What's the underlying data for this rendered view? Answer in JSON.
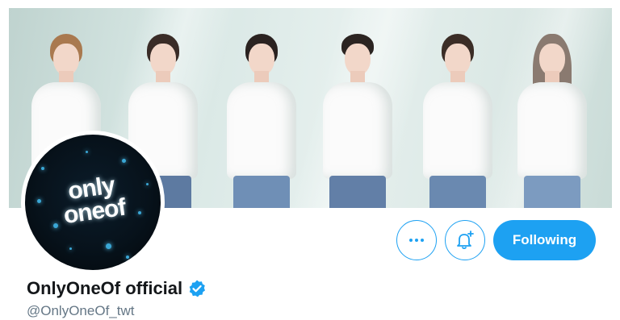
{
  "profile": {
    "display_name": "OnlyOneOf official",
    "handle": "@OnlyOneOf_twt",
    "verified": true,
    "avatar_text_line1": "only",
    "avatar_text_line2": "oneof"
  },
  "actions": {
    "more_icon": "more-horizontal-icon",
    "notify_icon": "bell-plus-icon",
    "follow_label": "Following"
  },
  "colors": {
    "accent": "#1da1f2",
    "name_text": "#14171a",
    "handle_text": "#657786"
  }
}
